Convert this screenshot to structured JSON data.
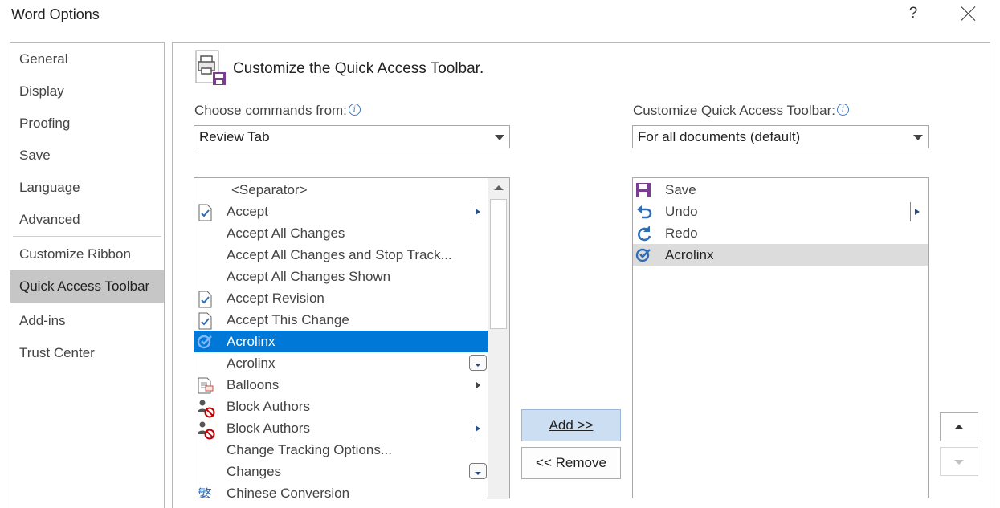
{
  "window": {
    "title": "Word Options",
    "help_label": "?"
  },
  "nav": {
    "items": [
      {
        "label": "General"
      },
      {
        "label": "Display"
      },
      {
        "label": "Proofing"
      },
      {
        "label": "Save"
      },
      {
        "label": "Language"
      },
      {
        "label": "Advanced"
      },
      {
        "label": "Customize Ribbon"
      },
      {
        "label": "Quick Access Toolbar",
        "selected": true
      },
      {
        "label": "Add-ins"
      },
      {
        "label": "Trust Center"
      }
    ]
  },
  "main": {
    "heading": "Customize the Quick Access Toolbar.",
    "heading_icon": "printer-save-icon",
    "choose_label": "Choose commands from:",
    "choose_value": "Review Tab",
    "customize_label": "Customize Quick Access Toolbar:",
    "customize_value": "For all documents (default)",
    "commands": [
      {
        "label": "<Separator>",
        "icon": "",
        "extra": ""
      },
      {
        "label": "Accept",
        "icon": "document-check-icon",
        "extra": "submenu"
      },
      {
        "label": "Accept All Changes",
        "icon": "",
        "extra": ""
      },
      {
        "label": "Accept All Changes and Stop Track...",
        "icon": "",
        "extra": ""
      },
      {
        "label": "Accept All Changes Shown",
        "icon": "",
        "extra": ""
      },
      {
        "label": "Accept Revision",
        "icon": "document-check-icon",
        "extra": ""
      },
      {
        "label": "Accept This Change",
        "icon": "document-check-icon",
        "extra": ""
      },
      {
        "label": "Acrolinx",
        "icon": "acrolinx-icon",
        "extra": "",
        "selected": true
      },
      {
        "label": "Acrolinx",
        "icon": "",
        "extra": "dropdown"
      },
      {
        "label": "Balloons",
        "icon": "balloons-icon",
        "extra": "split"
      },
      {
        "label": "Block Authors",
        "icon": "block-authors-icon",
        "extra": ""
      },
      {
        "label": "Block Authors",
        "icon": "block-authors-icon",
        "extra": "submenu"
      },
      {
        "label": "Change Tracking Options...",
        "icon": "",
        "extra": ""
      },
      {
        "label": "Changes",
        "icon": "",
        "extra": "dropdown"
      },
      {
        "label": "Chinese Conversion",
        "icon": "chinese-conversion-icon",
        "extra": ""
      }
    ],
    "toolbar_items": [
      {
        "label": "Save",
        "icon": "save-icon",
        "extra": ""
      },
      {
        "label": "Undo",
        "icon": "undo-icon",
        "extra": "submenu"
      },
      {
        "label": "Redo",
        "icon": "redo-icon",
        "extra": ""
      },
      {
        "label": "Acrolinx",
        "icon": "acrolinx-icon",
        "extra": "",
        "selected": true
      }
    ],
    "add_button": "Add >>",
    "remove_button": "<< Remove"
  },
  "colors": {
    "selection": "#0078d7",
    "nav_selected": "#c6c6c6",
    "add_button_bg": "#ccdef2",
    "icon_blue": "#2f6db5",
    "save_purple": "#7a3d8f"
  }
}
